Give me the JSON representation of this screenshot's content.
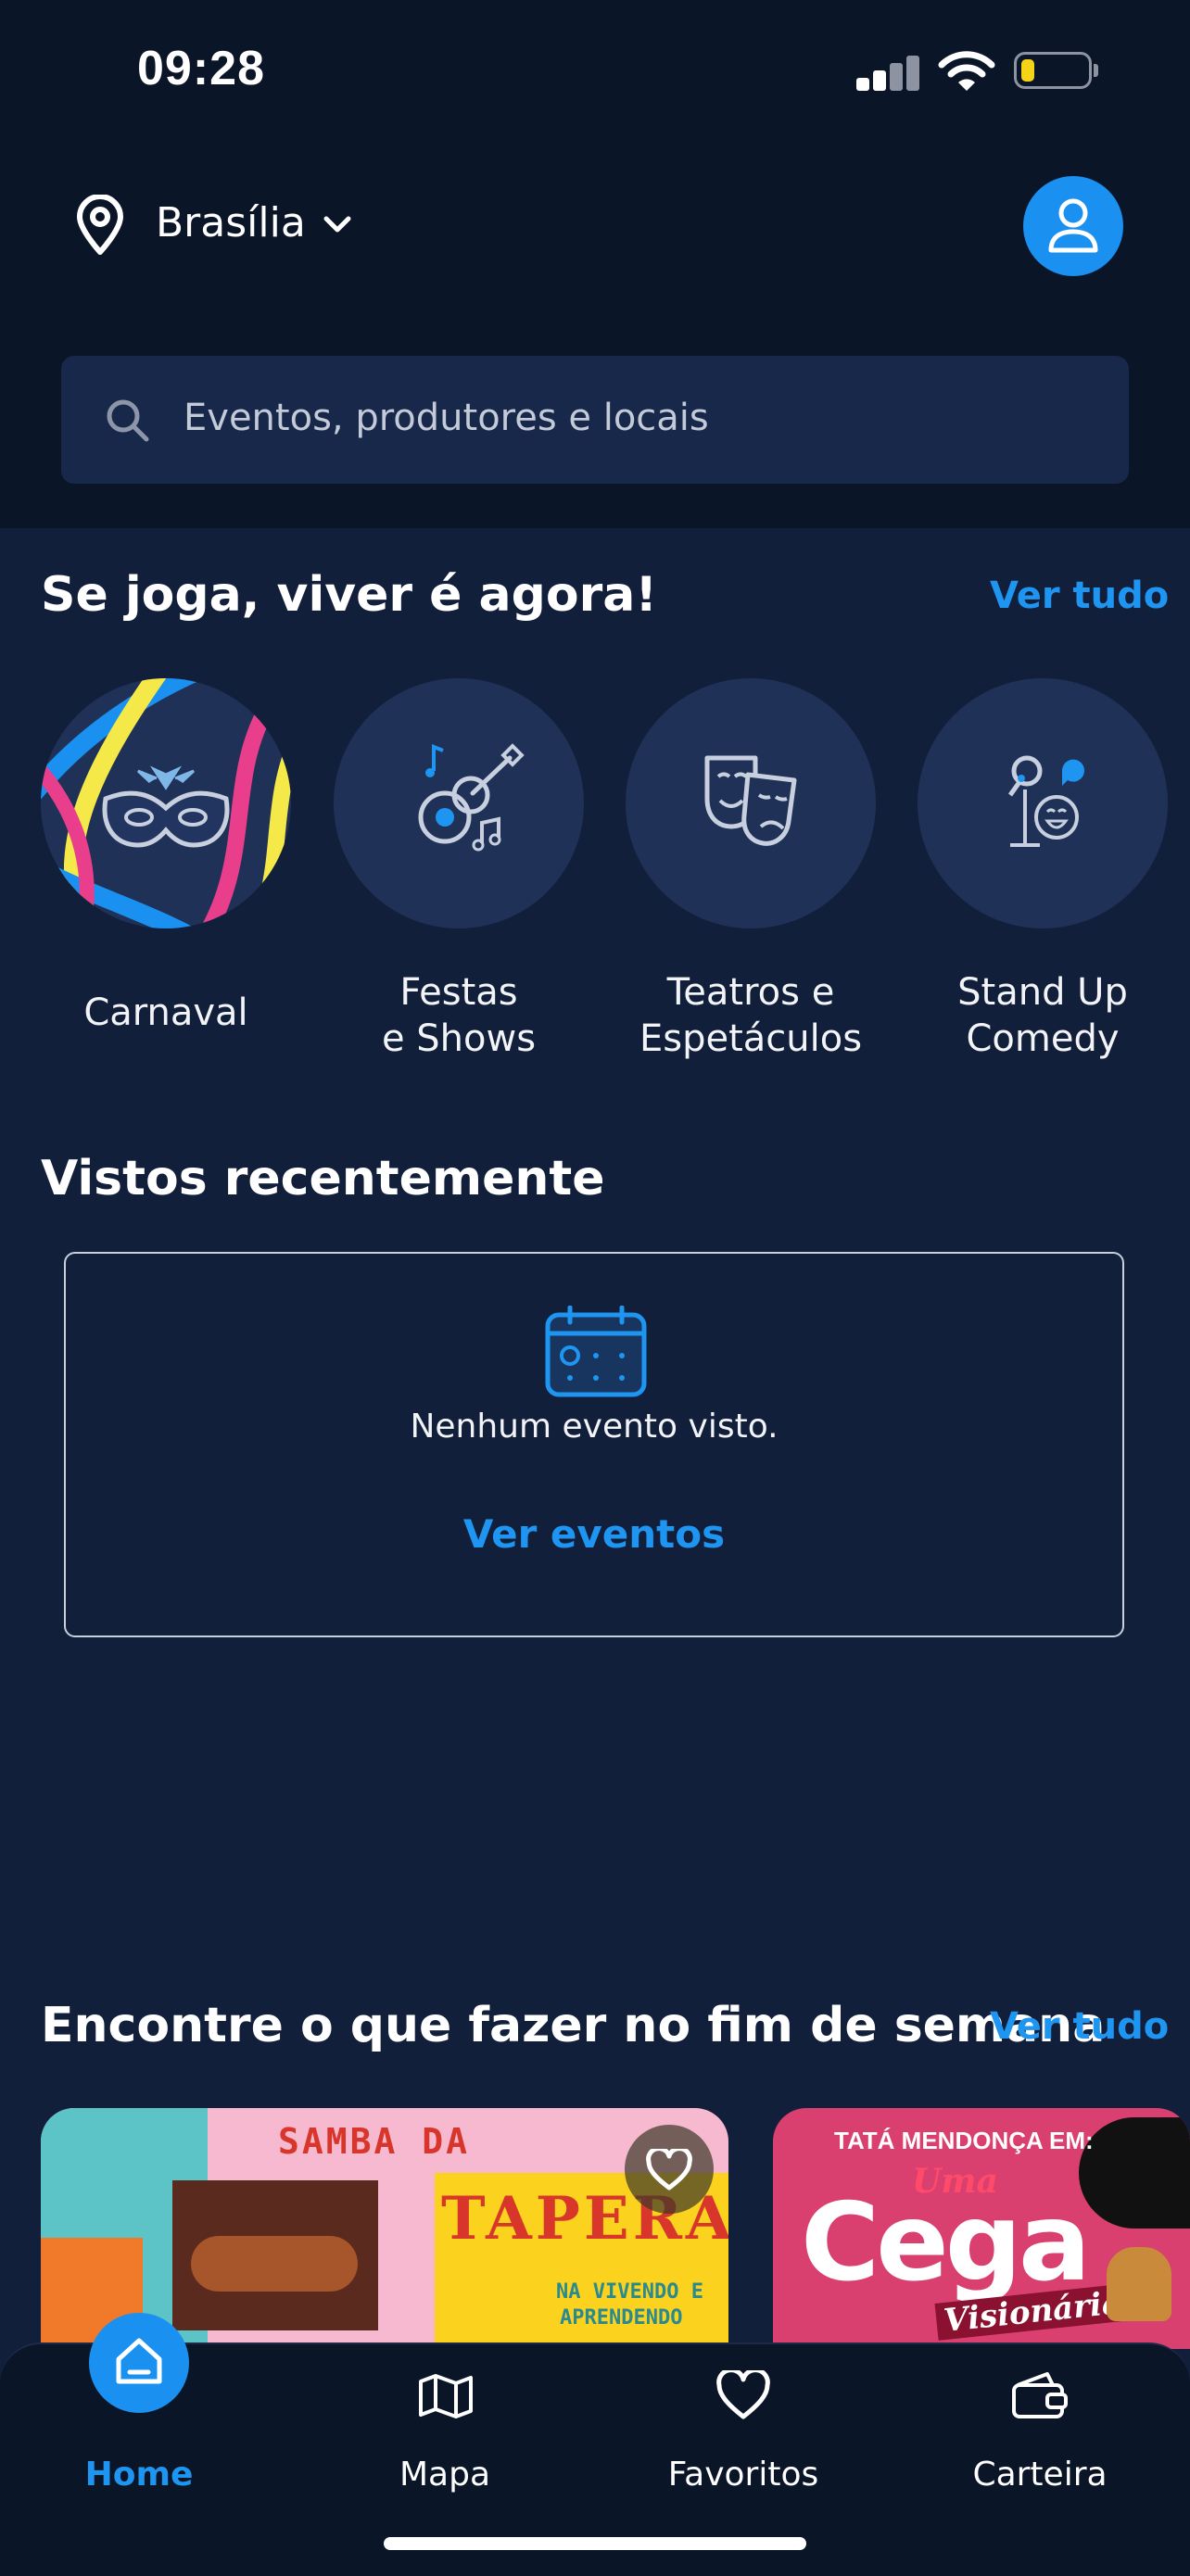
{
  "status_bar": {
    "time": "09:28",
    "battery_level": 0.2
  },
  "header": {
    "location": "Brasília",
    "search_placeholder": "Eventos, produtores e locais"
  },
  "categories_section": {
    "title": "Se joga, viver é agora!",
    "see_all": "Ver tudo",
    "items": [
      {
        "label": "Carnaval",
        "icon": "carnival-mask-icon"
      },
      {
        "label": "Festas\ne Shows",
        "icon": "guitar-music-icon"
      },
      {
        "label": "Teatros e\nEspetáculos",
        "icon": "theater-masks-icon"
      },
      {
        "label": "Stand Up\nComedy",
        "icon": "microphone-laugh-icon"
      }
    ]
  },
  "recent_section": {
    "title": "Vistos recentemente",
    "empty_text": "Nenhum evento visto.",
    "action": "Ver eventos"
  },
  "weekend_section": {
    "title": "Encontre o que fazer no fim de semana",
    "see_all": "Ver tudo",
    "cards": [
      {
        "title_line1": "SAMBA DA",
        "title_line2": "TAPERA",
        "subtitle_line1": "NA VIVENDO E",
        "subtitle_line2": "APRENDENDO"
      },
      {
        "pre_title": "TATÁ MENDONÇA EM:",
        "title_small": "Uma",
        "title_big": "Cega",
        "subtitle": "Visionária"
      }
    ]
  },
  "tab_bar": {
    "tabs": [
      {
        "label": "Home",
        "active": true,
        "icon": "home-icon"
      },
      {
        "label": "Mapa",
        "active": false,
        "icon": "map-icon"
      },
      {
        "label": "Favoritos",
        "active": false,
        "icon": "heart-icon"
      },
      {
        "label": "Carteira",
        "active": false,
        "icon": "wallet-icon"
      }
    ]
  },
  "colors": {
    "accent": "#1f95f2",
    "background": "#121f3b",
    "header_bg": "#0b1528",
    "battery": "#f5d418"
  }
}
